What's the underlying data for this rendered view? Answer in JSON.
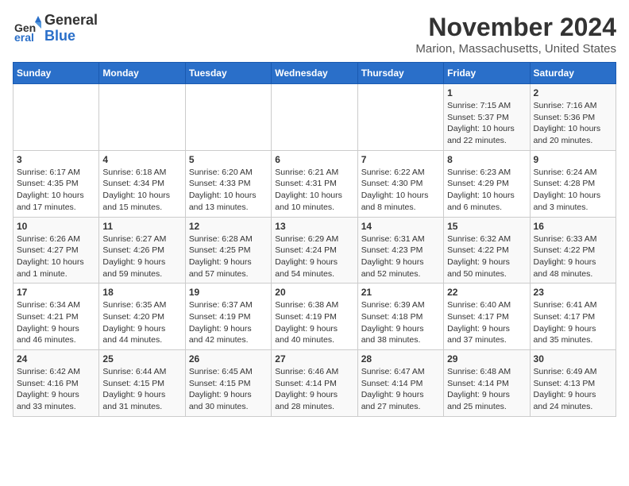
{
  "header": {
    "logo_general": "General",
    "logo_blue": "Blue",
    "month_year": "November 2024",
    "location": "Marion, Massachusetts, United States"
  },
  "days_of_week": [
    "Sunday",
    "Monday",
    "Tuesday",
    "Wednesday",
    "Thursday",
    "Friday",
    "Saturday"
  ],
  "weeks": [
    [
      {
        "day": "",
        "info": ""
      },
      {
        "day": "",
        "info": ""
      },
      {
        "day": "",
        "info": ""
      },
      {
        "day": "",
        "info": ""
      },
      {
        "day": "",
        "info": ""
      },
      {
        "day": "1",
        "info": "Sunrise: 7:15 AM\nSunset: 5:37 PM\nDaylight: 10 hours\nand 22 minutes."
      },
      {
        "day": "2",
        "info": "Sunrise: 7:16 AM\nSunset: 5:36 PM\nDaylight: 10 hours\nand 20 minutes."
      }
    ],
    [
      {
        "day": "3",
        "info": "Sunrise: 6:17 AM\nSunset: 4:35 PM\nDaylight: 10 hours\nand 17 minutes."
      },
      {
        "day": "4",
        "info": "Sunrise: 6:18 AM\nSunset: 4:34 PM\nDaylight: 10 hours\nand 15 minutes."
      },
      {
        "day": "5",
        "info": "Sunrise: 6:20 AM\nSunset: 4:33 PM\nDaylight: 10 hours\nand 13 minutes."
      },
      {
        "day": "6",
        "info": "Sunrise: 6:21 AM\nSunset: 4:31 PM\nDaylight: 10 hours\nand 10 minutes."
      },
      {
        "day": "7",
        "info": "Sunrise: 6:22 AM\nSunset: 4:30 PM\nDaylight: 10 hours\nand 8 minutes."
      },
      {
        "day": "8",
        "info": "Sunrise: 6:23 AM\nSunset: 4:29 PM\nDaylight: 10 hours\nand 6 minutes."
      },
      {
        "day": "9",
        "info": "Sunrise: 6:24 AM\nSunset: 4:28 PM\nDaylight: 10 hours\nand 3 minutes."
      }
    ],
    [
      {
        "day": "10",
        "info": "Sunrise: 6:26 AM\nSunset: 4:27 PM\nDaylight: 10 hours\nand 1 minute."
      },
      {
        "day": "11",
        "info": "Sunrise: 6:27 AM\nSunset: 4:26 PM\nDaylight: 9 hours\nand 59 minutes."
      },
      {
        "day": "12",
        "info": "Sunrise: 6:28 AM\nSunset: 4:25 PM\nDaylight: 9 hours\nand 57 minutes."
      },
      {
        "day": "13",
        "info": "Sunrise: 6:29 AM\nSunset: 4:24 PM\nDaylight: 9 hours\nand 54 minutes."
      },
      {
        "day": "14",
        "info": "Sunrise: 6:31 AM\nSunset: 4:23 PM\nDaylight: 9 hours\nand 52 minutes."
      },
      {
        "day": "15",
        "info": "Sunrise: 6:32 AM\nSunset: 4:22 PM\nDaylight: 9 hours\nand 50 minutes."
      },
      {
        "day": "16",
        "info": "Sunrise: 6:33 AM\nSunset: 4:22 PM\nDaylight: 9 hours\nand 48 minutes."
      }
    ],
    [
      {
        "day": "17",
        "info": "Sunrise: 6:34 AM\nSunset: 4:21 PM\nDaylight: 9 hours\nand 46 minutes."
      },
      {
        "day": "18",
        "info": "Sunrise: 6:35 AM\nSunset: 4:20 PM\nDaylight: 9 hours\nand 44 minutes."
      },
      {
        "day": "19",
        "info": "Sunrise: 6:37 AM\nSunset: 4:19 PM\nDaylight: 9 hours\nand 42 minutes."
      },
      {
        "day": "20",
        "info": "Sunrise: 6:38 AM\nSunset: 4:19 PM\nDaylight: 9 hours\nand 40 minutes."
      },
      {
        "day": "21",
        "info": "Sunrise: 6:39 AM\nSunset: 4:18 PM\nDaylight: 9 hours\nand 38 minutes."
      },
      {
        "day": "22",
        "info": "Sunrise: 6:40 AM\nSunset: 4:17 PM\nDaylight: 9 hours\nand 37 minutes."
      },
      {
        "day": "23",
        "info": "Sunrise: 6:41 AM\nSunset: 4:17 PM\nDaylight: 9 hours\nand 35 minutes."
      }
    ],
    [
      {
        "day": "24",
        "info": "Sunrise: 6:42 AM\nSunset: 4:16 PM\nDaylight: 9 hours\nand 33 minutes."
      },
      {
        "day": "25",
        "info": "Sunrise: 6:44 AM\nSunset: 4:15 PM\nDaylight: 9 hours\nand 31 minutes."
      },
      {
        "day": "26",
        "info": "Sunrise: 6:45 AM\nSunset: 4:15 PM\nDaylight: 9 hours\nand 30 minutes."
      },
      {
        "day": "27",
        "info": "Sunrise: 6:46 AM\nSunset: 4:14 PM\nDaylight: 9 hours\nand 28 minutes."
      },
      {
        "day": "28",
        "info": "Sunrise: 6:47 AM\nSunset: 4:14 PM\nDaylight: 9 hours\nand 27 minutes."
      },
      {
        "day": "29",
        "info": "Sunrise: 6:48 AM\nSunset: 4:14 PM\nDaylight: 9 hours\nand 25 minutes."
      },
      {
        "day": "30",
        "info": "Sunrise: 6:49 AM\nSunset: 4:13 PM\nDaylight: 9 hours\nand 24 minutes."
      }
    ]
  ]
}
